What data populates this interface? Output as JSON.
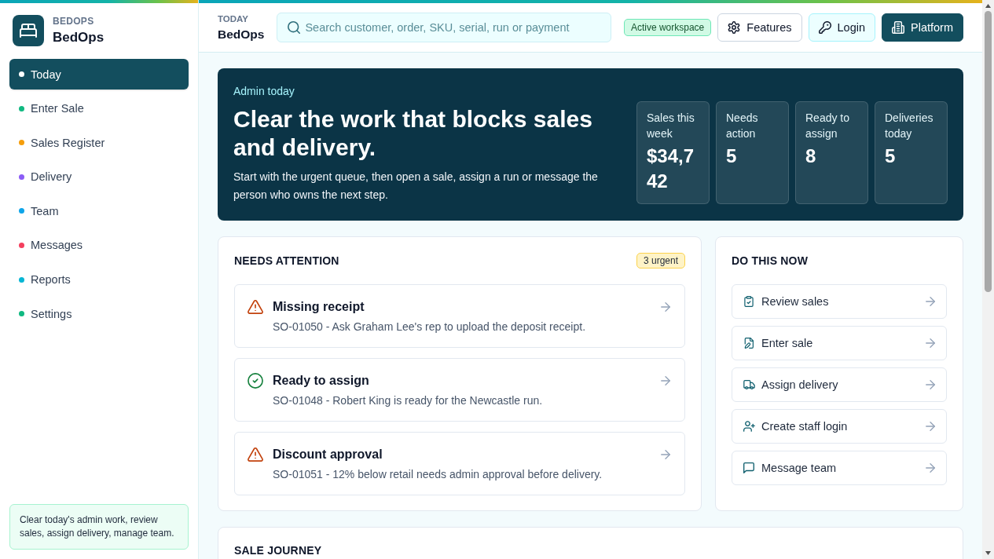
{
  "sidebar": {
    "brand": {
      "eyebrow": "BEDOPS",
      "name": "BedOps"
    },
    "items": [
      {
        "label": "Today",
        "selected": true,
        "color": "#ffffff"
      },
      {
        "label": "Enter Sale",
        "selected": false,
        "color": "#10b981"
      },
      {
        "label": "Sales Register",
        "selected": false,
        "color": "#f59e0b"
      },
      {
        "label": "Delivery",
        "selected": false,
        "color": "#8b5cf6"
      },
      {
        "label": "Team",
        "selected": false,
        "color": "#0ea5e9"
      },
      {
        "label": "Messages",
        "selected": false,
        "color": "#f43f5e"
      },
      {
        "label": "Reports",
        "selected": false,
        "color": "#06b6d4"
      },
      {
        "label": "Settings",
        "selected": false,
        "color": "#10b981"
      }
    ],
    "note": "Clear today's admin work, review sales, assign delivery, manage team."
  },
  "header": {
    "eyebrow": "TODAY",
    "title": "BedOps",
    "search": {
      "placeholder": "Search customer, order, SKU, serial, run or payment"
    },
    "badge": "Active workspace",
    "buttons": [
      {
        "label": "Features",
        "kind": "outline"
      },
      {
        "label": "Login",
        "kind": "soft"
      },
      {
        "label": "Platform",
        "kind": "primary"
      }
    ]
  },
  "hero": {
    "eyebrow": "Admin today",
    "title": "Clear the work that blocks sales and delivery.",
    "text": "Start with the urgent queue, then open a sale, assign a run or message the person who owns the next step.",
    "stats": [
      {
        "label": "Sales this week",
        "value": "$34,742"
      },
      {
        "label": "Needs action",
        "value": "5"
      },
      {
        "label": "Ready to assign",
        "value": "8"
      },
      {
        "label": "Deliveries today",
        "value": "5"
      }
    ]
  },
  "needs_attention": {
    "title": "NEEDS ATTENTION",
    "badge": "3 urgent",
    "items": [
      {
        "kind": "warning",
        "title": "Missing receipt",
        "text": "SO-01050 - Ask Graham Lee's rep to upload the deposit receipt."
      },
      {
        "kind": "ready",
        "title": "Ready to assign",
        "text": "SO-01048 - Robert King is ready for the Newcastle run."
      },
      {
        "kind": "warning",
        "title": "Discount approval",
        "text": "SO-01051 - 12% below retail needs admin approval before delivery."
      }
    ]
  },
  "do_this_now": {
    "title": "DO THIS NOW",
    "actions": [
      "Review sales",
      "Enter sale",
      "Assign delivery",
      "Create staff login",
      "Message team"
    ]
  },
  "sale_journey": {
    "title": "SALE JOURNEY"
  }
}
